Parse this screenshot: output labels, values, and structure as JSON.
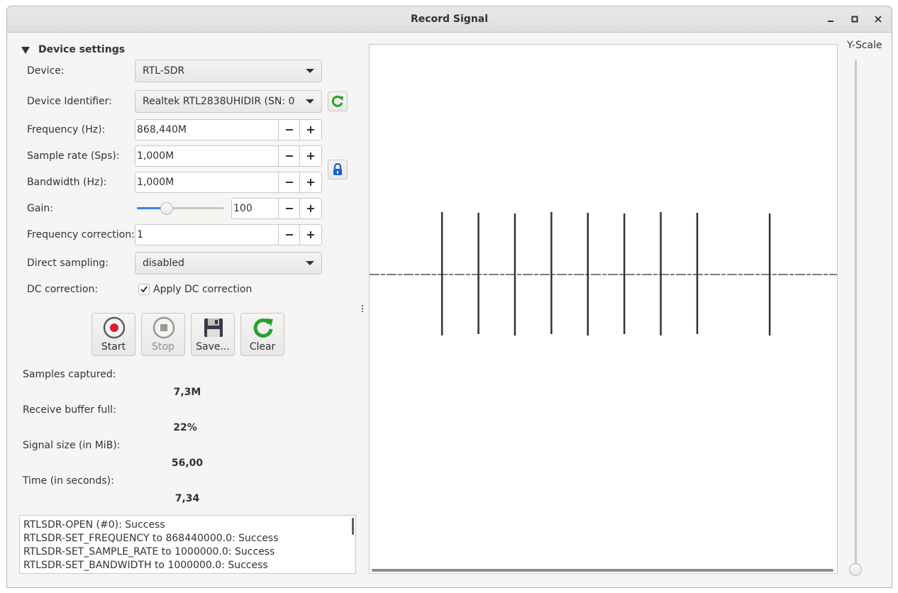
{
  "window": {
    "title": "Record Signal"
  },
  "device_settings": {
    "header": "Device settings",
    "device": {
      "label": "Device:",
      "value": "RTL-SDR"
    },
    "device_identifier": {
      "label": "Device Identifier:",
      "value": "Realtek RTL2838UHIDIR (SN: 0"
    },
    "frequency": {
      "label": "Frequency (Hz):",
      "value": "868,440M"
    },
    "sample_rate": {
      "label": "Sample rate (Sps):",
      "value": "1,000M"
    },
    "bandwidth": {
      "label": "Bandwidth (Hz):",
      "value": "1,000M"
    },
    "gain": {
      "label": "Gain:",
      "value": "100",
      "slider_fraction": 0.34
    },
    "frequency_correction": {
      "label": "Frequency correction:",
      "value": "1"
    },
    "direct_sampling": {
      "label": "Direct sampling:",
      "value": "disabled"
    },
    "dc_correction": {
      "label": "DC correction:",
      "checkbox_label": "Apply DC correction",
      "checked": true
    }
  },
  "buttons": {
    "start": "Start",
    "stop": "Stop",
    "save": "Save...",
    "clear": "Clear"
  },
  "stats": {
    "samples_label": "Samples captured:",
    "samples_value": "7,3M",
    "buffer_label": "Receive buffer full:",
    "buffer_value": "22%",
    "size_label": "Signal size (in MiB):",
    "size_value": "56,00",
    "time_label": "Time (in seconds):",
    "time_value": "7,34"
  },
  "log": [
    "RTLSDR-OPEN (#0): Success",
    "RTLSDR-SET_FREQUENCY to 868440000.0: Success",
    "RTLSDR-SET_SAMPLE_RATE to 1000000.0: Success",
    "RTLSDR-SET_BANDWIDTH to 1000000.0: Success"
  ],
  "yscale": {
    "label": "Y-Scale"
  },
  "signal": {
    "pulse_positions": [
      0.155,
      0.233,
      0.311,
      0.389,
      0.467,
      0.545,
      0.623,
      0.701,
      0.856
    ]
  },
  "colors": {
    "accent": "#3584e4",
    "record_red": "#e01b24",
    "refresh_green": "#2aa02a",
    "lock_blue": "#1c62c6",
    "signal": "#2e3436"
  }
}
